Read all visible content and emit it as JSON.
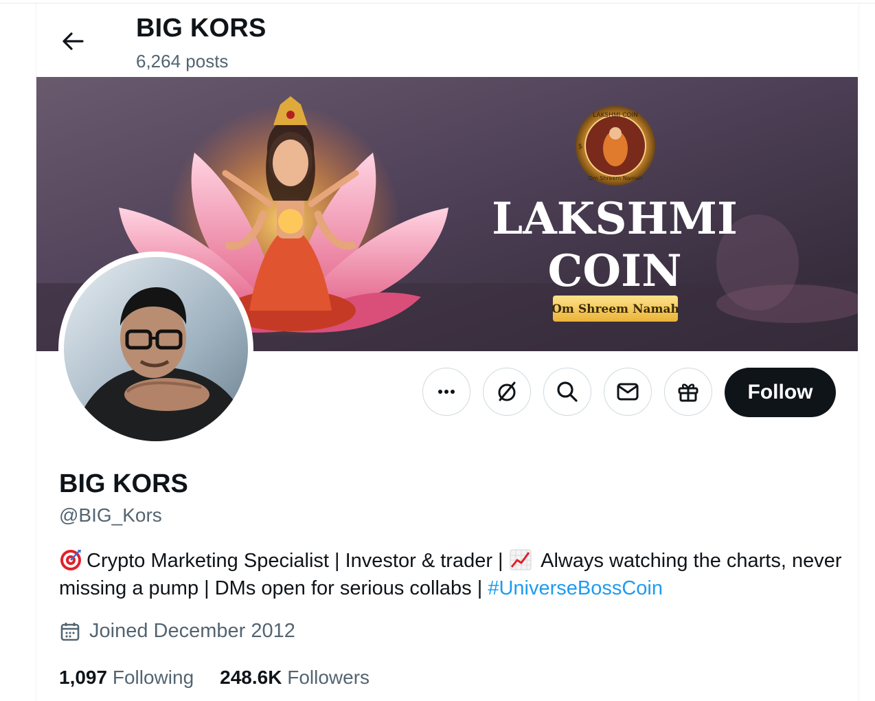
{
  "header": {
    "back_icon": "arrow-left-icon",
    "name": "BIG KORS",
    "posts": "6,264 posts"
  },
  "banner": {
    "coin_line1": "LAKSHMI",
    "coin_line2": "COIN",
    "tag": "Om Shreem Namah",
    "emblem_top": "LAKSHMI COIN",
    "emblem_bottom": "Om Shreem Namah",
    "emblem_side": "$"
  },
  "actions": {
    "more_icon": "more-dots-icon",
    "grok_icon": "grok-icon",
    "search_icon": "search-icon",
    "message_icon": "envelope-icon",
    "gift_icon": "gift-icon",
    "follow_label": "Follow"
  },
  "profile": {
    "display_name": "BIG KORS",
    "handle": "@BIG_Kors",
    "bio_part1": "Crypto Marketing Specialist |  Investor & trader  | ",
    "bio_part2": " Always watching the charts, never missing a pump  |  DMs open for serious collabs | ",
    "bio_hashtag": "#UniverseBossCoin",
    "bio_emoji1": "target-emoji",
    "bio_emoji2": "chart-increasing-emoji",
    "joined": "Joined December 2012",
    "joined_icon": "calendar-icon"
  },
  "stats": {
    "following_count": "1,097",
    "following_label": "Following",
    "followers_count": "248.6K",
    "followers_label": "Followers"
  },
  "colors": {
    "text": "#0f1419",
    "secondary": "#536471",
    "link": "#1d9bf0",
    "follow_bg": "#0f1419"
  }
}
